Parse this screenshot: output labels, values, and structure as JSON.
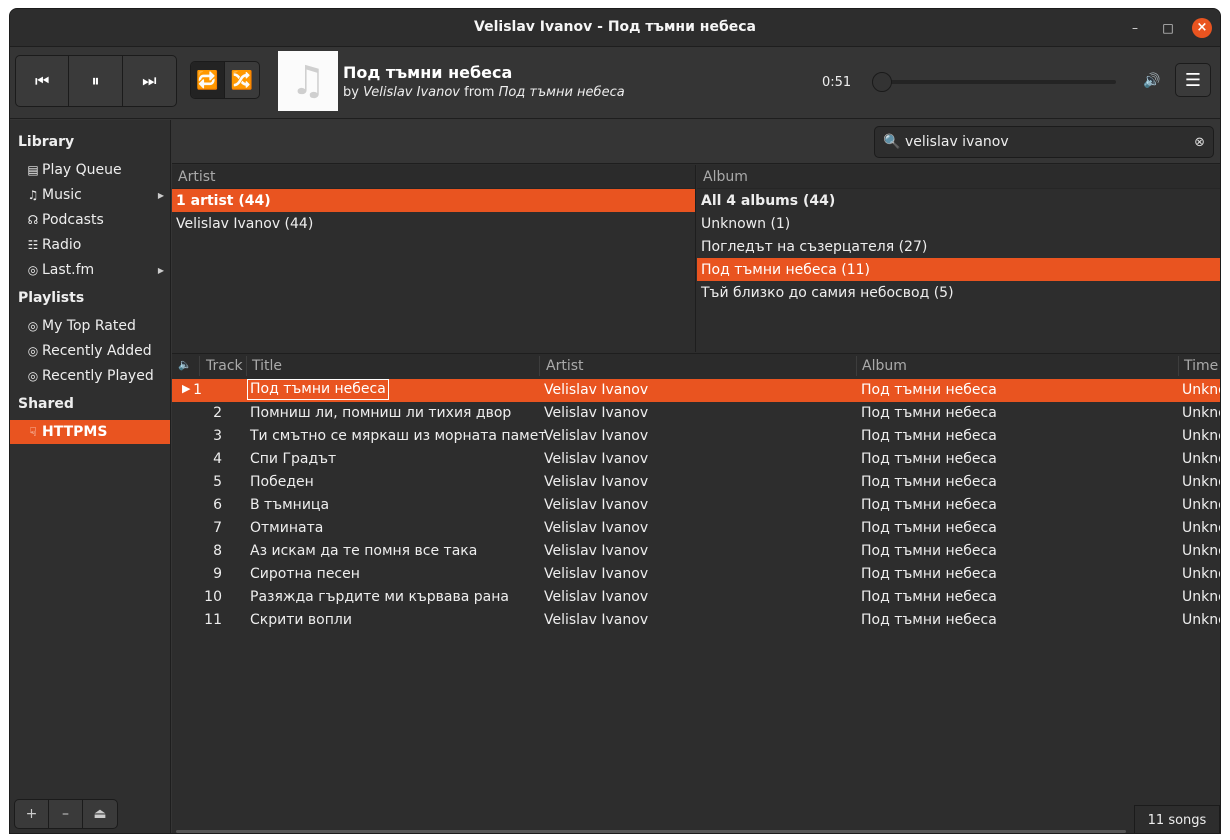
{
  "window": {
    "title": "Velislav Ivanov - Под тъмни небеса"
  },
  "window_controls": {
    "minimize": "–",
    "maximize": "□",
    "close": "×"
  },
  "toolbar": {
    "prev_icon": "⏮",
    "pause_icon": "⏸",
    "next_icon": "⏭",
    "repeat_icon": "🔁",
    "shuffle_icon": "🔀",
    "cover_icon": "♫",
    "now_playing": {
      "title": "Под тъмни небеса",
      "by": "by",
      "artist": "Velislav Ivanov",
      "from": "from",
      "album": "Под тъмни небеса"
    },
    "position": "0:51",
    "progress": 0.0,
    "volume_icon": "🔊",
    "menu_icon": "☰"
  },
  "sidebar": {
    "library_heading": "Library",
    "library": [
      {
        "icon": "▤",
        "label": "Play Queue"
      },
      {
        "icon": "♫",
        "label": "Music"
      },
      {
        "icon": "☊",
        "label": "Podcasts"
      },
      {
        "icon": "☷",
        "label": "Radio"
      },
      {
        "icon": "◎",
        "label": "Last.fm"
      }
    ],
    "playlists_heading": "Playlists",
    "playlists": [
      {
        "icon": "◎",
        "label": "My Top Rated"
      },
      {
        "icon": "◎",
        "label": "Recently Added"
      },
      {
        "icon": "◎",
        "label": "Recently Played"
      }
    ],
    "shared_heading": "Shared",
    "shared": [
      {
        "icon": "☟",
        "label": "HTTPMS"
      }
    ],
    "bottom": {
      "add": "+",
      "remove": "–",
      "eject": "⏏"
    }
  },
  "search": {
    "value": "velislav ivanov",
    "search_icon": "🔍",
    "clear_icon": "⊗"
  },
  "artist_browser": {
    "header": "Artist",
    "rows": [
      "1 artist (44)",
      "Velislav Ivanov (44)"
    ]
  },
  "album_browser": {
    "header": "Album",
    "rows": [
      "All 4 albums (44)",
      "Unknown (1)",
      "Погледът на съзерцателя (27)",
      "Под тъмни небеса (11)",
      "Тъй близко до самия небосвод (5)"
    ]
  },
  "tracks": {
    "headers": {
      "speaker": "🔈",
      "track": "Track",
      "title": "Title",
      "artist": "Artist",
      "album": "Album",
      "time": "Time"
    },
    "playing_icon": "▶",
    "rows": [
      {
        "n": "1",
        "title": "Под тъмни небеса",
        "artist": "Velislav Ivanov",
        "album": "Под тъмни небеса",
        "time": "Unknown"
      },
      {
        "n": "2",
        "title": "Помниш ли, помниш ли тихия двор",
        "artist": "Velislav Ivanov",
        "album": "Под тъмни небеса",
        "time": "Unknown"
      },
      {
        "n": "3",
        "title": "Ти смътно се мяркаш из морната памет",
        "artist": "Velislav Ivanov",
        "album": "Под тъмни небеса",
        "time": "Unknown"
      },
      {
        "n": "4",
        "title": "Спи Градът",
        "artist": "Velislav Ivanov",
        "album": "Под тъмни небеса",
        "time": "Unknown"
      },
      {
        "n": "5",
        "title": "Победен",
        "artist": "Velislav Ivanov",
        "album": "Под тъмни небеса",
        "time": "Unknown"
      },
      {
        "n": "6",
        "title": "В тъмница",
        "artist": "Velislav Ivanov",
        "album": "Под тъмни небеса",
        "time": "Unknown"
      },
      {
        "n": "7",
        "title": "Отмината",
        "artist": "Velislav Ivanov",
        "album": "Под тъмни небеса",
        "time": "Unknown"
      },
      {
        "n": "8",
        "title": "Аз искам да те помня все така",
        "artist": "Velislav Ivanov",
        "album": "Под тъмни небеса",
        "time": "Unknown"
      },
      {
        "n": "9",
        "title": "Сиротна песен",
        "artist": "Velislav Ivanov",
        "album": "Под тъмни небеса",
        "time": "Unknown"
      },
      {
        "n": "10",
        "title": "Разяжда гърдите ми кървава рана",
        "artist": "Velislav Ivanov",
        "album": "Под тъмни небеса",
        "time": "Unknown"
      },
      {
        "n": "11",
        "title": "Скрити вопли",
        "artist": "Velislav Ivanov",
        "album": "Под тъмни небеса",
        "time": "Unknown"
      }
    ]
  },
  "status": {
    "count": "11 songs"
  },
  "colors": {
    "accent": "#e95420",
    "background": "#2d2d2d",
    "toolbar": "#353535"
  }
}
